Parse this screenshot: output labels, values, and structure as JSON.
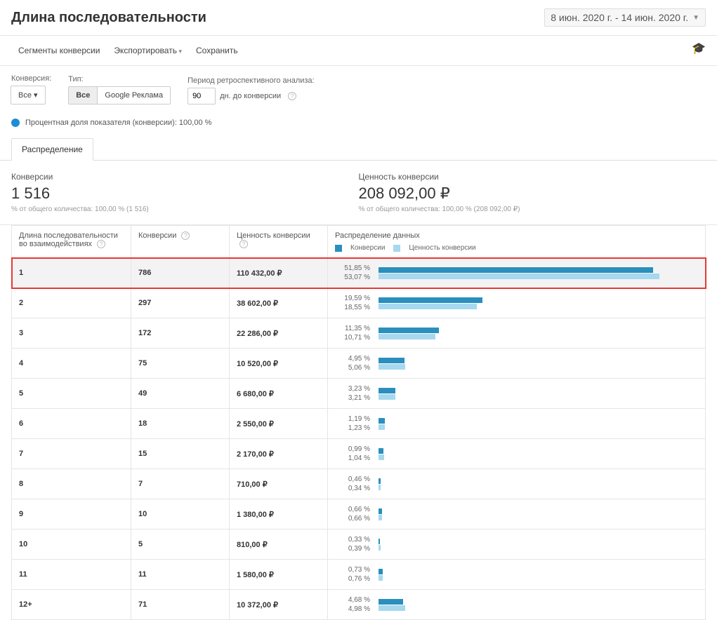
{
  "header": {
    "title": "Длина последовательности",
    "date_range": "8 июн. 2020 г. - 14 июн. 2020 г."
  },
  "toolbar": {
    "segments": "Сегменты конверсии",
    "export": "Экспортировать",
    "save": "Сохранить"
  },
  "filters": {
    "conversion_label": "Конверсия:",
    "conversion_all": "Все",
    "type_label": "Тип:",
    "type_all": "Все",
    "type_google": "Google Реклама",
    "retro_label": "Период ретроспективного анализа:",
    "retro_value": "90",
    "retro_unit": "дн. до конверсии"
  },
  "legend": {
    "text": "Процентная доля показателя (конверсии): 100,00 %"
  },
  "tab": "Распределение",
  "summary": {
    "conversions_label": "Конверсии",
    "conversions_value": "1 516",
    "conversions_sub": "% от общего количества: 100,00 % (1 516)",
    "value_label": "Ценность конверсии",
    "value_value": "208 092,00 ₽",
    "value_sub": "% от общего количества: 100,00 % (208 092,00 ₽)"
  },
  "table": {
    "headers": {
      "seq": "Длина последовательности во взаимодействиях",
      "conv": "Конверсии",
      "val": "Ценность конверсии",
      "dist": "Распределение данных",
      "dist_conv": "Конверсии",
      "dist_val": "Ценность конверсии"
    },
    "rows": [
      {
        "seq": "1",
        "conv": "786",
        "val": "110 432,00 ₽",
        "p1": "51,85 %",
        "p2": "53,07 %",
        "w1": 51.85,
        "w2": 53.07,
        "hl": true
      },
      {
        "seq": "2",
        "conv": "297",
        "val": "38 602,00 ₽",
        "p1": "19,59 %",
        "p2": "18,55 %",
        "w1": 19.59,
        "w2": 18.55
      },
      {
        "seq": "3",
        "conv": "172",
        "val": "22 286,00 ₽",
        "p1": "11,35 %",
        "p2": "10,71 %",
        "w1": 11.35,
        "w2": 10.71
      },
      {
        "seq": "4",
        "conv": "75",
        "val": "10 520,00 ₽",
        "p1": "4,95 %",
        "p2": "5,06 %",
        "w1": 4.95,
        "w2": 5.06
      },
      {
        "seq": "5",
        "conv": "49",
        "val": "6 680,00 ₽",
        "p1": "3,23 %",
        "p2": "3,21 %",
        "w1": 3.23,
        "w2": 3.21
      },
      {
        "seq": "6",
        "conv": "18",
        "val": "2 550,00 ₽",
        "p1": "1,19 %",
        "p2": "1,23 %",
        "w1": 1.19,
        "w2": 1.23
      },
      {
        "seq": "7",
        "conv": "15",
        "val": "2 170,00 ₽",
        "p1": "0,99 %",
        "p2": "1,04 %",
        "w1": 0.99,
        "w2": 1.04
      },
      {
        "seq": "8",
        "conv": "7",
        "val": "710,00 ₽",
        "p1": "0,46 %",
        "p2": "0,34 %",
        "w1": 0.46,
        "w2": 0.34
      },
      {
        "seq": "9",
        "conv": "10",
        "val": "1 380,00 ₽",
        "p1": "0,66 %",
        "p2": "0,66 %",
        "w1": 0.66,
        "w2": 0.66
      },
      {
        "seq": "10",
        "conv": "5",
        "val": "810,00 ₽",
        "p1": "0,33 %",
        "p2": "0,39 %",
        "w1": 0.33,
        "w2": 0.39
      },
      {
        "seq": "11",
        "conv": "11",
        "val": "1 580,00 ₽",
        "p1": "0,73 %",
        "p2": "0,76 %",
        "w1": 0.73,
        "w2": 0.76
      },
      {
        "seq": "12+",
        "conv": "71",
        "val": "10 372,00 ₽",
        "p1": "4,68 %",
        "p2": "4,98 %",
        "w1": 4.68,
        "w2": 4.98
      }
    ]
  },
  "chart_data": {
    "type": "table",
    "title": "Длина последовательности — Распределение",
    "series": [
      {
        "name": "Конверсии (%)",
        "values": [
          51.85,
          19.59,
          11.35,
          4.95,
          3.23,
          1.19,
          0.99,
          0.46,
          0.66,
          0.33,
          0.73,
          4.68
        ]
      },
      {
        "name": "Ценность конверсии (%)",
        "values": [
          53.07,
          18.55,
          10.71,
          5.06,
          3.21,
          1.23,
          1.04,
          0.34,
          0.66,
          0.39,
          0.76,
          4.98
        ]
      }
    ],
    "categories": [
      "1",
      "2",
      "3",
      "4",
      "5",
      "6",
      "7",
      "8",
      "9",
      "10",
      "11",
      "12+"
    ]
  }
}
